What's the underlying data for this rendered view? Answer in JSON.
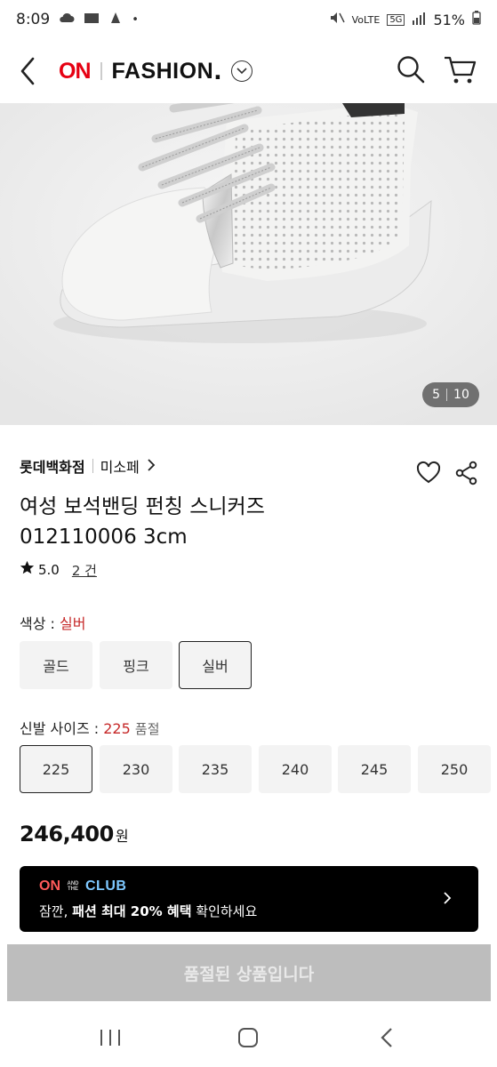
{
  "status_bar": {
    "time": "8:09",
    "battery": "51%",
    "network": "5G"
  },
  "header": {
    "brand_on": "ON",
    "brand_fashion": "FASHION",
    "brand_dot": "."
  },
  "gallery": {
    "current": "5",
    "total": "10"
  },
  "product": {
    "store": "롯데백화점",
    "brand": "미소페",
    "title_line1": "여성 보석밴딩 펀칭 스니커즈",
    "title_line2": "012110006 3cm",
    "rating": "5.0",
    "review_count": "2 건"
  },
  "color_option": {
    "label": "색상 : ",
    "selected": "실버",
    "options": [
      "골드",
      "핑크",
      "실버"
    ]
  },
  "size_option": {
    "label": "신발 사이즈 : ",
    "selected": "225",
    "status": "품절",
    "options": [
      "225",
      "230",
      "235",
      "240",
      "245",
      "250"
    ]
  },
  "price": {
    "amount": "246,400",
    "unit": "원"
  },
  "club_banner": {
    "logo_on": "ON",
    "logo_small": "AND THE",
    "logo_club": "CLUB",
    "message_pre": "잠깐, ",
    "message_bold": "패션 최대 20% 혜택",
    "message_post": " 확인하세요"
  },
  "sold_out_button": "품절된 상품입니다",
  "colors": {
    "brand_red": "#e60012",
    "accent_red": "#c62828"
  }
}
